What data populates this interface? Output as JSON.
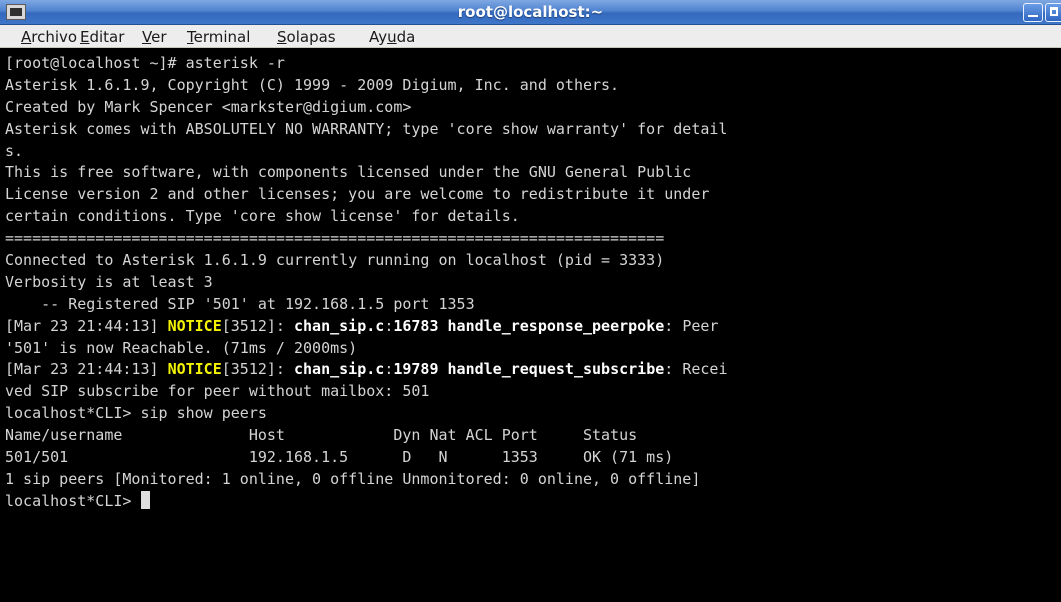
{
  "window": {
    "title": "root@localhost:~"
  },
  "menubar": {
    "items": [
      {
        "pre": "",
        "mnemonic": "A",
        "post": "rchivo"
      },
      {
        "pre": "",
        "mnemonic": "E",
        "post": "ditar"
      },
      {
        "pre": "",
        "mnemonic": "V",
        "post": "er"
      },
      {
        "pre": "",
        "mnemonic": "T",
        "post": "erminal"
      },
      {
        "pre": "",
        "mnemonic": "S",
        "post": "olapas"
      },
      {
        "pre": "Ay",
        "mnemonic": "u",
        "post": "da"
      }
    ]
  },
  "terminal": {
    "lines": [
      [
        {
          "t": "[root@localhost ~]# asterisk -r"
        }
      ],
      [
        {
          "t": "Asterisk 1.6.1.9, Copyright (C) 1999 - 2009 Digium, Inc. and others."
        }
      ],
      [
        {
          "t": "Created by Mark Spencer <markster@digium.com>"
        }
      ],
      [
        {
          "t": "Asterisk comes with ABSOLUTELY NO WARRANTY; type 'core show warranty' for detail"
        }
      ],
      [
        {
          "t": "s."
        }
      ],
      [
        {
          "t": "This is free software, with components licensed under the GNU General Public"
        }
      ],
      [
        {
          "t": "License version 2 and other licenses; you are welcome to redistribute it under"
        }
      ],
      [
        {
          "t": "certain conditions. Type 'core show license' for details."
        }
      ],
      [
        {
          "t": "========================================================================="
        }
      ],
      [
        {
          "t": "Connected to Asterisk 1.6.1.9 currently running on localhost (pid = 3333)"
        }
      ],
      [
        {
          "t": "Verbosity is at least 3"
        }
      ],
      [
        {
          "t": "    -- Registered SIP '501' at 192.168.1.5 port 1353"
        }
      ],
      [
        {
          "t": "[Mar 23 21:44:13] "
        },
        {
          "t": "NOTICE",
          "s": "y"
        },
        {
          "t": "[3512]: "
        },
        {
          "t": "chan_sip.c",
          "s": "b"
        },
        {
          "t": ":"
        },
        {
          "t": "16783 handle_response_peerpoke",
          "s": "b"
        },
        {
          "t": ": Peer"
        }
      ],
      [
        {
          "t": "'501' is now Reachable. (71ms / 2000ms)"
        }
      ],
      [
        {
          "t": "[Mar 23 21:44:13] "
        },
        {
          "t": "NOTICE",
          "s": "y"
        },
        {
          "t": "[3512]: "
        },
        {
          "t": "chan_sip.c",
          "s": "b"
        },
        {
          "t": ":"
        },
        {
          "t": "19789 handle_request_subscribe",
          "s": "b"
        },
        {
          "t": ": Recei"
        }
      ],
      [
        {
          "t": "ved SIP subscribe for peer without mailbox: 501"
        }
      ],
      [
        {
          "t": "localhost*CLI> sip show peers"
        }
      ],
      [
        {
          "t": "Name/username              Host            Dyn Nat ACL Port     Status"
        }
      ],
      [
        {
          "t": "501/501                    192.168.1.5      D   N      1353     OK (71 ms)"
        }
      ],
      [
        {
          "t": "1 sip peers [Monitored: 1 online, 0 offline Unmonitored: 0 online, 0 offline]"
        }
      ],
      [
        {
          "t": "localhost*CLI> "
        }
      ]
    ]
  }
}
